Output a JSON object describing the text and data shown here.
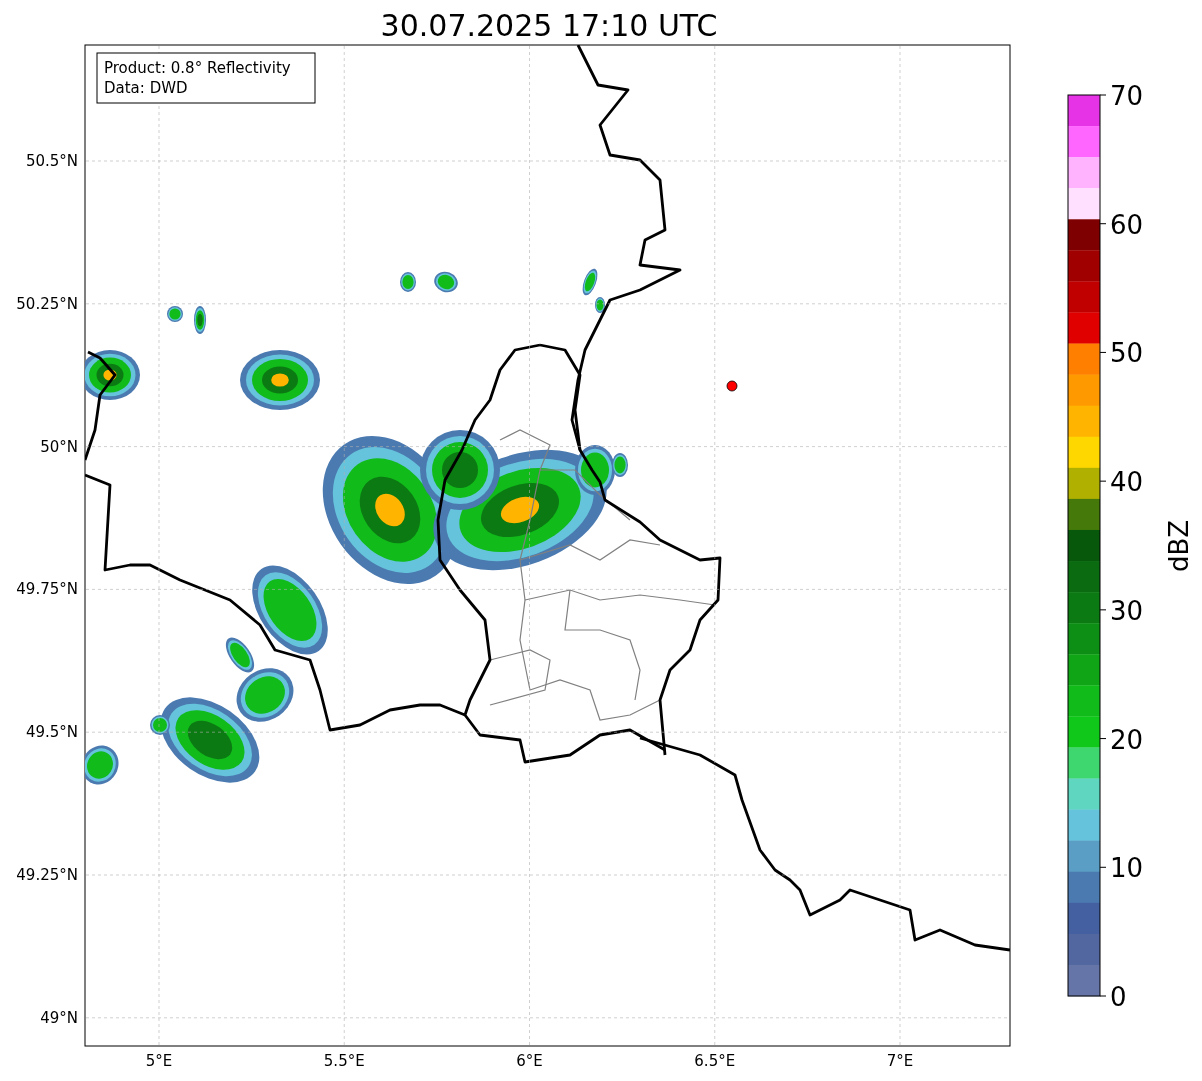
{
  "title": "30.07.2025 17:10 UTC",
  "info_box": [
    "Product: 0.8° Reflectivity",
    "Data: DWD"
  ],
  "lat_ticks": [
    "50.5°N",
    "50.25°N",
    "50°N",
    "49.75°N",
    "49.5°N",
    "49.25°N",
    "49°N"
  ],
  "lon_ticks": [
    "5°E",
    "5.5°E",
    "6°E",
    "6.5°E",
    "7°E"
  ],
  "colorbar": {
    "label": "dBZ",
    "ticks": [
      "70",
      "60",
      "50",
      "40",
      "30",
      "20",
      "10",
      "0"
    ],
    "bins": [
      {
        "color": "#e633e6"
      },
      {
        "color": "#ff66ff"
      },
      {
        "color": "#ffb3ff"
      },
      {
        "color": "#ffe0ff"
      },
      {
        "color": "#7f0000"
      },
      {
        "color": "#a00000"
      },
      {
        "color": "#c00000"
      },
      {
        "color": "#e00000"
      },
      {
        "color": "#ff7f00"
      },
      {
        "color": "#ff9900"
      },
      {
        "color": "#ffb400"
      },
      {
        "color": "#ffd700"
      },
      {
        "color": "#b0b000"
      },
      {
        "color": "#457a0a"
      },
      {
        "color": "#08580c"
      },
      {
        "color": "#0a6b10"
      },
      {
        "color": "#0b7a12"
      },
      {
        "color": "#0d8e15"
      },
      {
        "color": "#10a516"
      },
      {
        "color": "#10bb1a"
      },
      {
        "color": "#10c81a"
      },
      {
        "color": "#3dd66f"
      },
      {
        "color": "#5fd6c0"
      },
      {
        "color": "#66c3dc"
      },
      {
        "color": "#5a9dc5"
      },
      {
        "color": "#4b7ab0"
      },
      {
        "color": "#4460a0"
      },
      {
        "color": "#5267a0"
      },
      {
        "color": "#6575a8"
      }
    ]
  }
}
